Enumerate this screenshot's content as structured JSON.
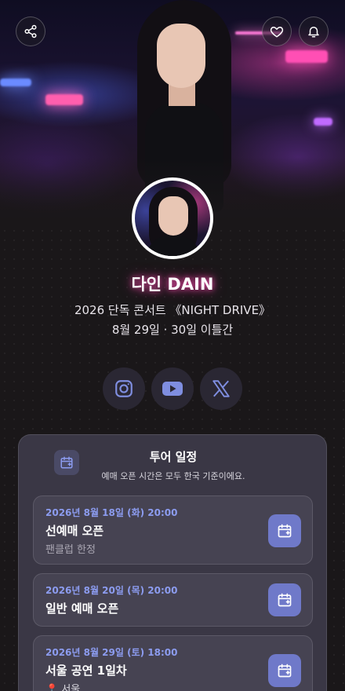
{
  "artist": {
    "name": "다인 DAIN",
    "subtitle": "2026 단독 콘서트 《NIGHT DRIVE》",
    "dates": "8월 29일 · 30일 이틀간"
  },
  "top_actions": {
    "share_icon": "share-icon",
    "like_icon": "heart-icon",
    "notify_icon": "bell-icon"
  },
  "socials": [
    {
      "icon": "instagram-icon"
    },
    {
      "icon": "youtube-icon"
    },
    {
      "icon": "x-icon"
    }
  ],
  "schedule": {
    "title": "투어 일정",
    "subtitle": "예매 오픈 시간은 모두 한국 기준이에요.",
    "events": [
      {
        "datetime": "2026년 8월 18일 (화) 20:00",
        "title": "선예매 오픈",
        "note": "팬클럽 한정"
      },
      {
        "datetime": "2026년 8월 20일 (목) 20:00",
        "title": "일반 예매 오픈",
        "note": ""
      },
      {
        "datetime": "2026년 8월 29일 (토) 18:00",
        "title": "서울 공연 1일차",
        "note": "📍 서울"
      }
    ]
  },
  "colors": {
    "accent": "#6f79c9",
    "date_text": "#8c9cf0",
    "background": "#1a1719",
    "card": "#3a3745"
  }
}
